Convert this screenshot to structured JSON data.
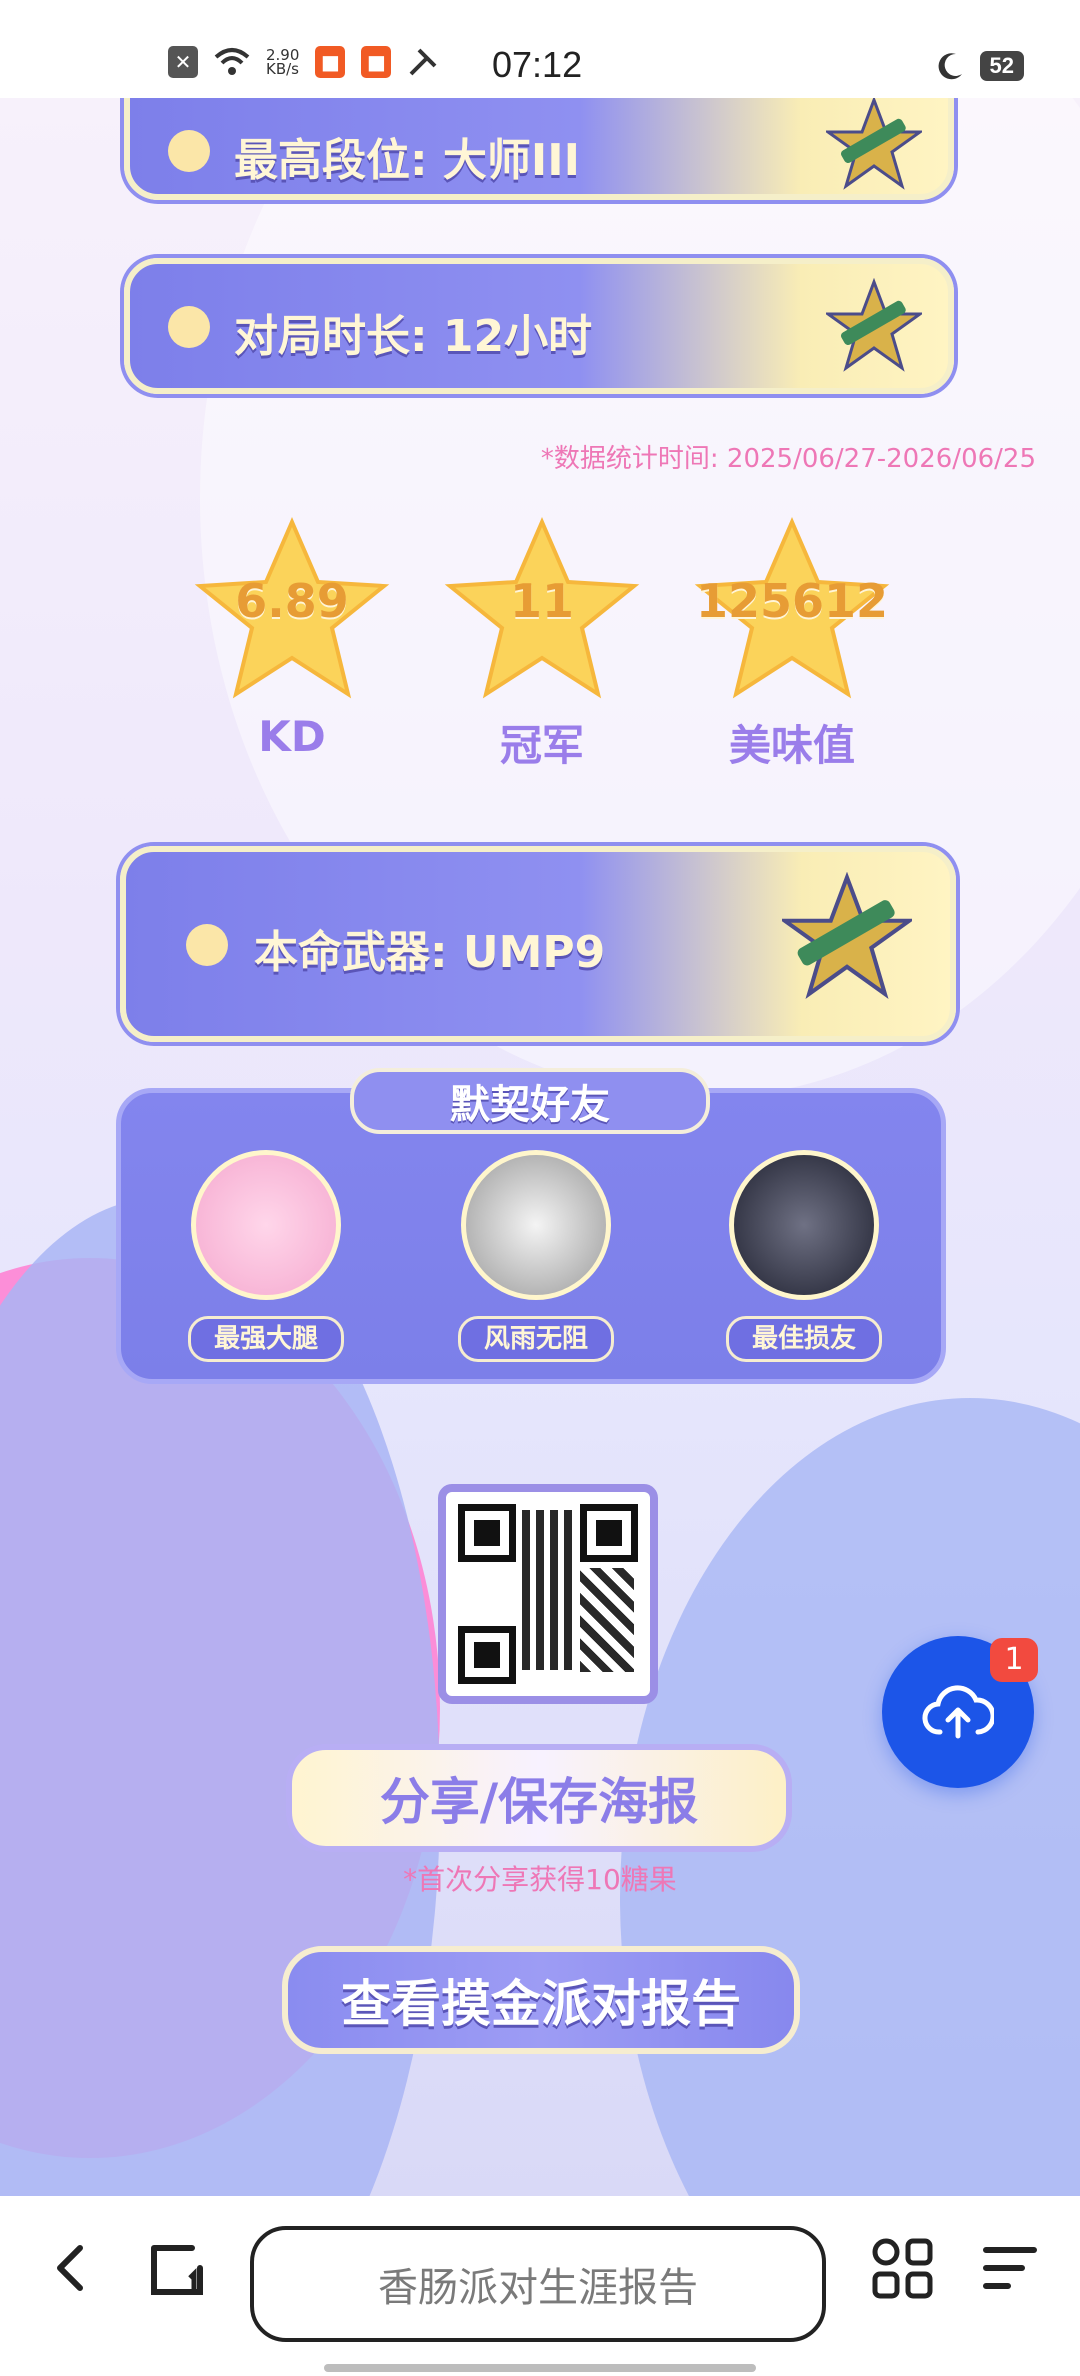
{
  "status_bar": {
    "speed": "2.90",
    "speed_unit": "KB/s",
    "time": "07:12",
    "battery": "52"
  },
  "cards": {
    "rank": "最高段位: 大师III",
    "duration": "对局时长: 12小时",
    "weapon": "本命武器: UMP9"
  },
  "stats_note": "*数据统计时间: 2025/06/27-2026/06/25",
  "stats": [
    {
      "value": "6.89",
      "label": "KD"
    },
    {
      "value": "11",
      "label": "冠军"
    },
    {
      "value": "125612",
      "label": "美味值"
    }
  ],
  "friends": {
    "title": "默契好友",
    "items": [
      {
        "tag": "最强大腿"
      },
      {
        "tag": "风雨无阻"
      },
      {
        "tag": "最佳损友"
      }
    ]
  },
  "buttons": {
    "share": "分享/保存海报",
    "share_note": "*首次分享获得10糖果",
    "report": "查看摸金派对报告"
  },
  "fab": {
    "badge": "1"
  },
  "browser": {
    "url_text": "香肠派对生涯报告"
  },
  "colors": {
    "accent": "#8f8ff0",
    "fab": "#1c55e8",
    "pink_note": "#ee77b6"
  },
  "icons": [
    "close-notification-icon",
    "wifi-icon",
    "app-icon",
    "tools-icon",
    "moon-icon",
    "cloud-upload-icon",
    "back-icon",
    "tabs-icon",
    "apps-grid-icon",
    "menu-icon"
  ]
}
